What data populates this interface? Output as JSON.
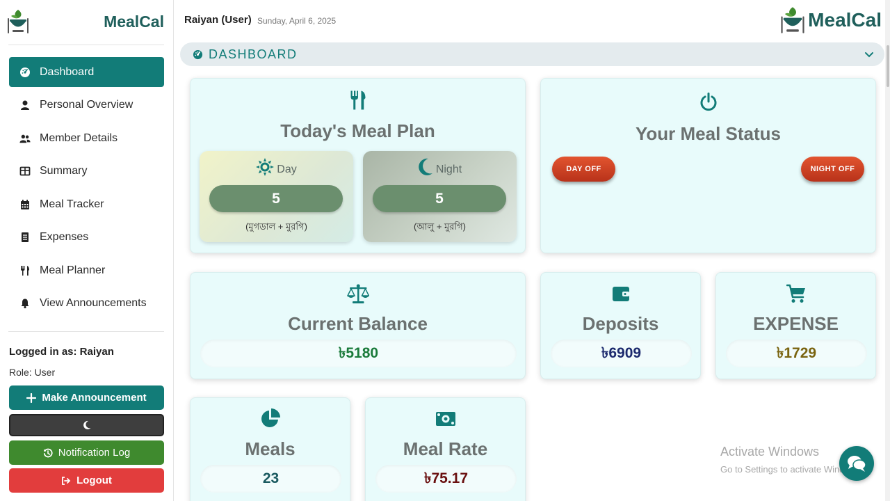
{
  "brand": {
    "name": "MealCal"
  },
  "sidebar": {
    "items": [
      {
        "label": "Dashboard",
        "icon": "dashboard-icon",
        "active": true
      },
      {
        "label": "Personal Overview",
        "icon": "user-icon"
      },
      {
        "label": "Member Details",
        "icon": "users-icon"
      },
      {
        "label": "Summary",
        "icon": "table-icon"
      },
      {
        "label": "Meal Tracker",
        "icon": "calendar-icon"
      },
      {
        "label": "Expenses",
        "icon": "receipt-icon"
      },
      {
        "label": "Meal Planner",
        "icon": "utensils-icon"
      },
      {
        "label": "View Announcements",
        "icon": "bell-icon"
      }
    ],
    "logged_in": "Logged in as: Raiyan",
    "role": "Role: User",
    "make_announcement": "Make Announcement",
    "notification_log": "Notification Log",
    "logout": "Logout"
  },
  "header": {
    "user": "Raiyan (User)",
    "date": "Sunday, April 6, 2025",
    "logo_text": "MealCal"
  },
  "dashboard": {
    "title": "DASHBOARD",
    "meal_plan": {
      "title": "Today's Meal Plan",
      "day": {
        "label": "Day",
        "count": "5",
        "menu": "(মুগডাল + মুরগি)"
      },
      "night": {
        "label": "Night",
        "count": "5",
        "menu": "(আলু + মুরগি)"
      }
    },
    "meal_status": {
      "title": "Your Meal Status",
      "day_button": "DAY OFF",
      "night_button": "NIGHT OFF"
    },
    "current_balance": {
      "title": "Current Balance",
      "value": "৳5180"
    },
    "deposits": {
      "title": "Deposits",
      "value": "৳6909"
    },
    "expense": {
      "title": "EXPENSE",
      "value": "৳1729"
    },
    "meals": {
      "title": "Meals",
      "value": "23"
    },
    "meal_rate": {
      "title": "Meal Rate",
      "value": "৳75.17"
    }
  },
  "watermark": {
    "line1": "Activate Windows",
    "line2": "Go to Settings to activate Windows."
  },
  "colors": {
    "primary": "#127c78",
    "balance": "#1a7a3a",
    "deposits": "#1c2a6e",
    "expense": "#7a6410",
    "meals": "#1a5a60",
    "meal_rate": "#6a1010"
  }
}
